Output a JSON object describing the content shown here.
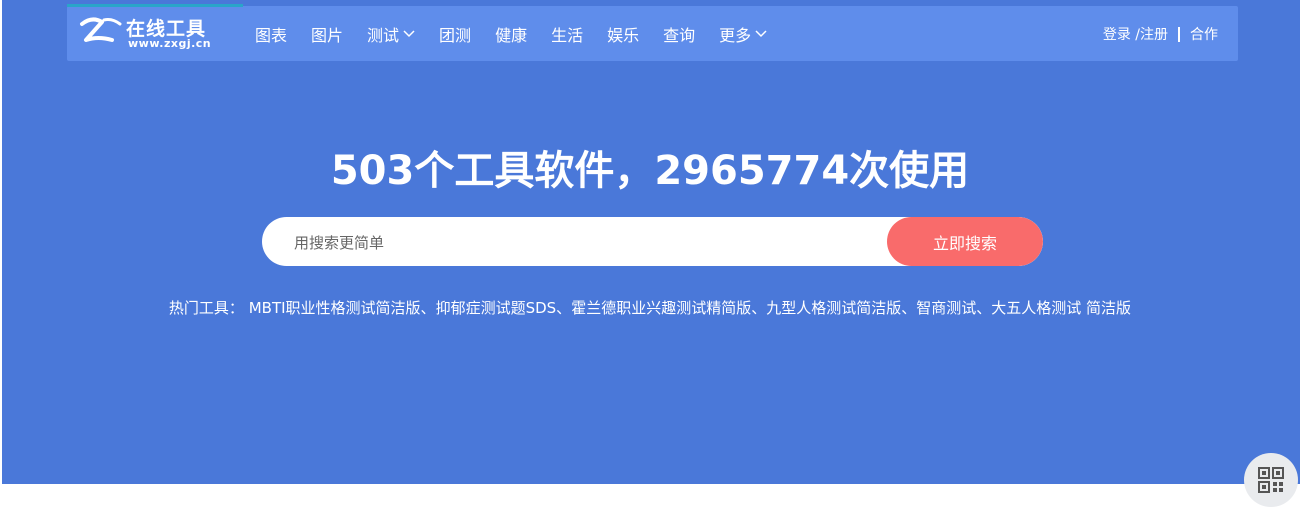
{
  "logo": {
    "title": "在线工具",
    "url": "www.zxgj.cn"
  },
  "nav": {
    "items": [
      {
        "label": "图表",
        "has_dropdown": false
      },
      {
        "label": "图片",
        "has_dropdown": false
      },
      {
        "label": "测试",
        "has_dropdown": true
      },
      {
        "label": "团测",
        "has_dropdown": false
      },
      {
        "label": "健康",
        "has_dropdown": false
      },
      {
        "label": "生活",
        "has_dropdown": false
      },
      {
        "label": "娱乐",
        "has_dropdown": false
      },
      {
        "label": "查询",
        "has_dropdown": false
      },
      {
        "label": "更多",
        "has_dropdown": true
      }
    ]
  },
  "user_links": {
    "login": "登录 /注册",
    "cooperate": "合作"
  },
  "hero": {
    "headline": "503个工具软件，2965774次使用"
  },
  "search": {
    "placeholder": "用搜索更简单",
    "value": "",
    "button_label": "立即搜索"
  },
  "hot_tools": {
    "label": "热门工具：",
    "items": [
      "MBTI职业性格测试简洁版",
      "抑郁症测试题SDS",
      "霍兰德职业兴趣测试精简版",
      "九型人格测试简洁版",
      "智商测试",
      "大五人格测试 简洁版"
    ],
    "separator": "、"
  },
  "colors": {
    "hero_bg": "#4a78d9",
    "topbar_bg": "#5f8deb",
    "search_button": "#f96b6b",
    "accent": "#2aa5c9"
  },
  "icons": {
    "logo": "zxgj-logo-icon",
    "dropdown": "chevron-down-icon",
    "qr": "qr-code-icon"
  }
}
